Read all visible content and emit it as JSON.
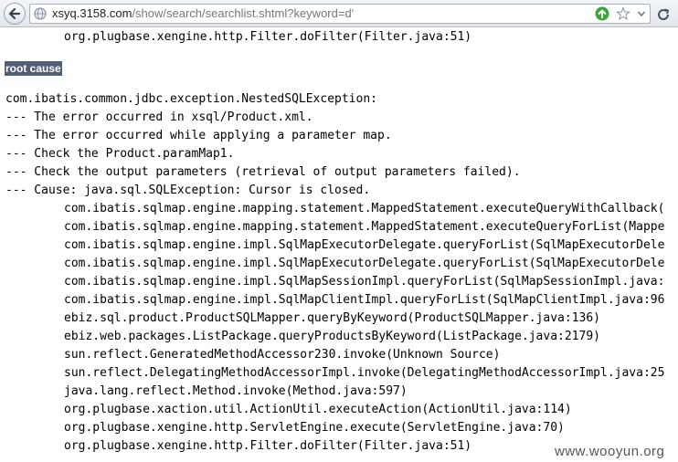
{
  "browser": {
    "url_host": "xsyq.3158.com",
    "url_path": "/show/search/searchlist.shtml?keyword=d'"
  },
  "trace": {
    "top_frame": "org.plugbase.xengine.http.Filter.doFilter(Filter.java:51)",
    "root_cause_label": "root cause",
    "exception_lines": [
      "com.ibatis.common.jdbc.exception.NestedSQLException:",
      "--- The error occurred in xsql/Product.xml.",
      "--- The error occurred while applying a parameter map.",
      "--- Check the Product.paramMap1.",
      "--- Check the output parameters (retrieval of output parameters failed).",
      "--- Cause: java.sql.SQLException: Cursor is closed."
    ],
    "stack_lines": [
      "com.ibatis.sqlmap.engine.mapping.statement.MappedStatement.executeQueryWithCallback(",
      "com.ibatis.sqlmap.engine.mapping.statement.MappedStatement.executeQueryForList(Mappe",
      "com.ibatis.sqlmap.engine.impl.SqlMapExecutorDelegate.queryForList(SqlMapExecutorDele",
      "com.ibatis.sqlmap.engine.impl.SqlMapExecutorDelegate.queryForList(SqlMapExecutorDele",
      "com.ibatis.sqlmap.engine.impl.SqlMapSessionImpl.queryForList(SqlMapSessionImpl.java:",
      "com.ibatis.sqlmap.engine.impl.SqlMapClientImpl.queryForList(SqlMapClientImpl.java:96",
      "ebiz.sql.product.ProductSQLMapper.queryByKeyword(ProductSQLMapper.java:136)",
      "ebiz.web.packages.ListPackage.queryProductsByKeyword(ListPackage.java:2179)",
      "sun.reflect.GeneratedMethodAccessor230.invoke(Unknown Source)",
      "sun.reflect.DelegatingMethodAccessorImpl.invoke(DelegatingMethodAccessorImpl.java:25",
      "java.lang.reflect.Method.invoke(Method.java:597)",
      "org.plugbase.xaction.util.ActionUtil.executeAction(ActionUtil.java:114)",
      "org.plugbase.xengine.http.ServletEngine.execute(ServletEngine.java:70)",
      "org.plugbase.xengine.http.Filter.doFilter(Filter.java:51)"
    ]
  },
  "watermark": "www.wooyun.org",
  "icons": {
    "back": "back-arrow-icon",
    "site": "globe-icon",
    "go": "go-arrow-icon",
    "bookmark": "star-icon",
    "dropdown": "chevron-down-icon",
    "reload": "reload-icon"
  },
  "colors": {
    "root_cause_bg": "#525d76",
    "go_button": "#3aa63a"
  }
}
